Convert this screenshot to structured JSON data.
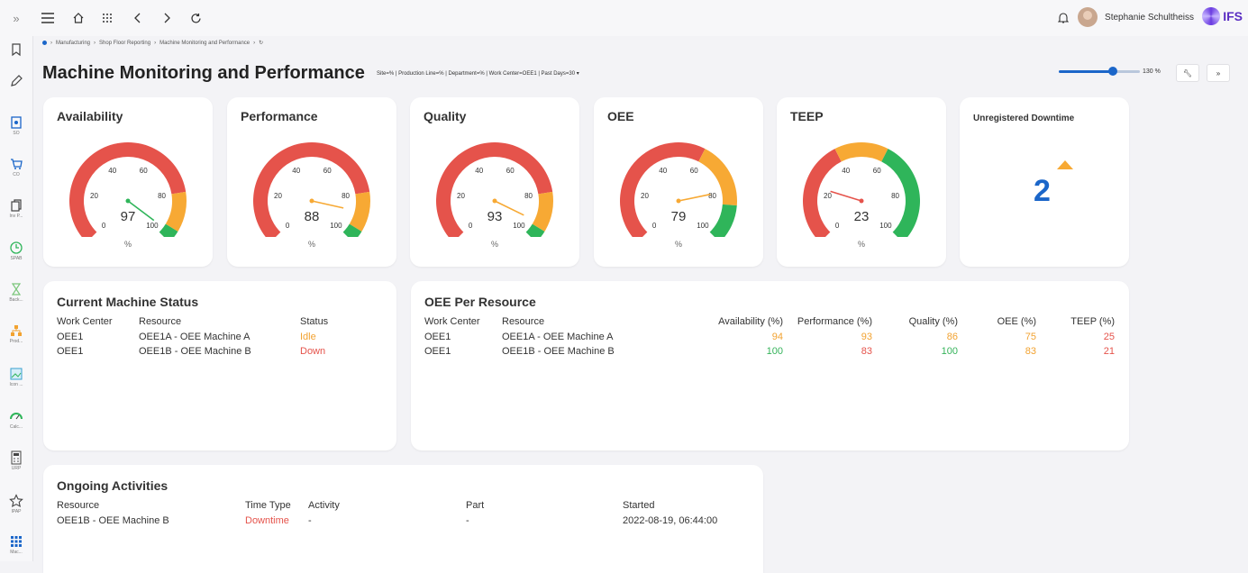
{
  "sidebar": {
    "items": [
      {
        "label": "",
        "icon": "bookmark-icon"
      },
      {
        "label": "",
        "icon": "pencil-icon"
      },
      {
        "label": "SO",
        "icon": "shop-order-icon"
      },
      {
        "label": "CO",
        "icon": "cart-icon"
      },
      {
        "label": "Inv P...",
        "icon": "inventory-icon"
      },
      {
        "label": "SPAB",
        "icon": "clock-icon"
      },
      {
        "label": "Back...",
        "icon": "backflush-icon"
      },
      {
        "label": "Prod...",
        "icon": "production-icon"
      },
      {
        "label": "Icon ...",
        "icon": "image-icon"
      },
      {
        "label": "Calc...",
        "icon": "gauge-icon"
      },
      {
        "label": "URP",
        "icon": "calculator-icon"
      },
      {
        "label": "IPAP",
        "icon": "star-icon"
      },
      {
        "label": "Mac...",
        "icon": "grid-icon"
      }
    ]
  },
  "topbar": {
    "user_name": "Stephanie Schultheiss",
    "brand": "IFS"
  },
  "breadcrumb": [
    "Manufacturing",
    "Shop Floor Reporting",
    "Machine Monitoring and Performance"
  ],
  "page": {
    "title": "Machine Monitoring and Performance",
    "filter": "Site=% | Production Line=% | Department=% | Work Center=OEE1 | Past Days=30 ▾",
    "zoom_label": "130 %",
    "zoom_value": 0.72
  },
  "gauges": [
    {
      "title": "Availability",
      "value": 97,
      "unit": "%",
      "red_to": 80,
      "orange_to": 95
    },
    {
      "title": "Performance",
      "value": 88,
      "unit": "%",
      "red_to": 80,
      "orange_to": 95
    },
    {
      "title": "Quality",
      "value": 93,
      "unit": "%",
      "red_to": 80,
      "orange_to": 95
    },
    {
      "title": "OEE",
      "value": 79,
      "unit": "%",
      "red_to": 60,
      "orange_to": 85
    },
    {
      "title": "TEEP",
      "value": 23,
      "unit": "%",
      "red_to": 40,
      "orange_to": 60
    }
  ],
  "gauge_ticks": [
    "0",
    "20",
    "40",
    "60",
    "80",
    "100"
  ],
  "downtime": {
    "title": "Unregistered Downtime",
    "value": "2",
    "trend": "up"
  },
  "machine_status": {
    "title": "Current Machine Status",
    "headers": [
      "Work Center",
      "Resource",
      "Status"
    ],
    "rows": [
      {
        "work_center": "OEE1",
        "resource": "OEE1A - OEE Machine A",
        "status": "Idle",
        "status_color": "#f2a230"
      },
      {
        "work_center": "OEE1",
        "resource": "OEE1B - OEE Machine B",
        "status": "Down",
        "status_color": "#e5534b"
      }
    ]
  },
  "oee_resource": {
    "title": "OEE Per Resource",
    "headers": [
      "Work Center",
      "Resource",
      "Availability (%)",
      "Performance (%)",
      "Quality (%)",
      "OEE (%)",
      "TEEP (%)"
    ],
    "rows": [
      {
        "work_center": "OEE1",
        "resource": "OEE1A - OEE Machine A",
        "availability": "94",
        "performance": "93",
        "quality": "86",
        "oee": "75",
        "teep": "25"
      },
      {
        "work_center": "OEE1",
        "resource": "OEE1B - OEE Machine B",
        "availability": "100",
        "performance": "83",
        "quality": "100",
        "oee": "83",
        "teep": "21"
      }
    ]
  },
  "activities": {
    "title": "Ongoing Activities",
    "headers": [
      "Resource",
      "Time Type",
      "Activity",
      "Part",
      "Started"
    ],
    "rows": [
      {
        "resource": "OEE1B - OEE Machine B",
        "time_type": "Downtime",
        "activity": "-",
        "part": "-",
        "started": "2022-08-19, 06:44:00"
      }
    ]
  },
  "colors": {
    "red": "#e5534b",
    "orange": "#f7a934",
    "green": "#2fb55a",
    "accent": "#1b66c9"
  }
}
